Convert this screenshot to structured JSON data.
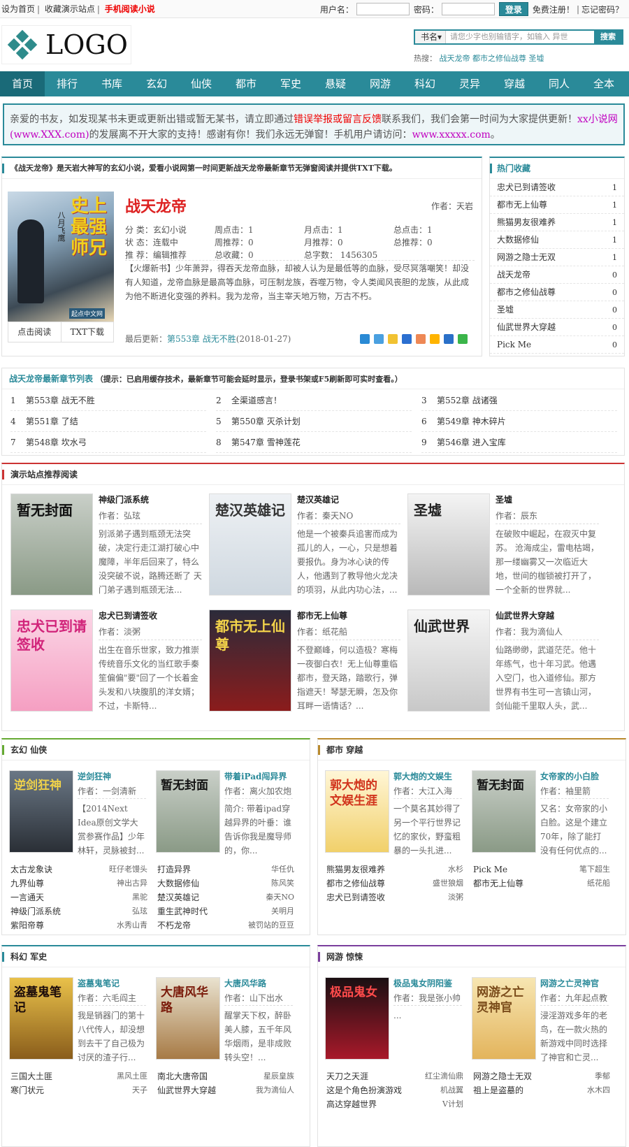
{
  "topbar": {
    "home": "设为首页",
    "fav": "收藏演示站点",
    "mobile": "手机阅读小说"
  },
  "login": {
    "user": "用户名：",
    "pass": "密码：",
    "btn": "登录",
    "reg": "免费注册！",
    "forgot": "忘记密码？"
  },
  "logo": {
    "text": "LOGO"
  },
  "search": {
    "type": "书名▾",
    "placeholder": "请您少字也别输错字，如输入 异世",
    "btn": "搜索"
  },
  "hot": {
    "label": "热搜：",
    "items": [
      "战天龙帝",
      "都市之修仙战尊",
      "圣墟"
    ]
  },
  "nav": [
    "首页",
    "排行",
    "书库",
    "玄幻",
    "仙侠",
    "都市",
    "军史",
    "悬疑",
    "网游",
    "科幻",
    "灵异",
    "穿越",
    "同人",
    "全本"
  ],
  "notice": {
    "p1": "亲爱的书友，如发现某书未更或更新出错或暂无某书，请立即通过",
    "link": "错误举报或留言反馈",
    "p2": "联系我们，我们会第一时间为大家提供更新！",
    "site": "xx小说网(www.XXX.com)",
    "p3": "的发展离不开大家的支持！感谢有你！我们永远无弹窗！手机用户请访问：",
    "url": "www.xxxxx.com",
    "p4": "。"
  },
  "book": {
    "intro": "《战天龙帝》是天岩大神写的玄幻小说，爱看小说网第一时间更新战天龙帝最新章节无弹窗阅读并提供TXT下载。",
    "title": "战天龙帝",
    "author": "作者：天岩",
    "f1": "分 类：玄幻小说",
    "f2": "周点击：1",
    "f3": "月点击：1",
    "f4": "总点击：1",
    "f5": "状 态：连载中",
    "f6": "周推荐：0",
    "f7": "月推荐：0",
    "f8": "总推荐：0",
    "f9": "推 荐：编辑推荐",
    "f10": "总收藏：0",
    "f11": "总字数： 1456305",
    "desc": "【火爆新书】少年萧羿，得吞天龙帝血脉，却被人认为是最低等的血脉，受尽冥落嘲笑！却没有人知道，龙帝血脉是最高等血脉，可压制龙族，吞噬万物，令人类闻风丧胆的龙族，从此成为他不断进化变强的养料。我为龙帝，当主宰天地万物，万古不朽。",
    "last_label": "最后更新：",
    "last_ch": "第553章 战无不胜",
    "last_date": "(2018-01-27)",
    "read": "点击阅读",
    "txt": "TXT下载",
    "cover_text": "史上最强师兄",
    "cover_author": "八月飞鹰",
    "cover_pub": "起点中文网"
  },
  "hotfav": {
    "title": "热门收藏",
    "items": [
      [
        "忠犬已到请签收",
        "1"
      ],
      [
        "都市无上仙尊",
        "1"
      ],
      [
        "熊猫男友很难养",
        "1"
      ],
      [
        "大数据修仙",
        "1"
      ],
      [
        "网游之隐士无双",
        "1"
      ],
      [
        "战天龙帝",
        "0"
      ],
      [
        "都市之修仙战尊",
        "0"
      ],
      [
        "圣墟",
        "0"
      ],
      [
        "仙武世界大穿越",
        "0"
      ],
      [
        "Pick Me",
        "0"
      ]
    ]
  },
  "chapters": {
    "title": "战天龙帝最新章节列表",
    "tip": "（提示：已启用缓存技术，最新章节可能会延时显示，登录书架或F5刷新即可实时查看。）",
    "items": [
      [
        "1",
        "第553章 战无不胜"
      ],
      [
        "2",
        "全渠道感言！"
      ],
      [
        "3",
        "第552章 战诸强"
      ],
      [
        "4",
        "第551章 了结"
      ],
      [
        "5",
        "第550章 灭杀计划"
      ],
      [
        "6",
        "第549章 神木碎片"
      ],
      [
        "7",
        "第548章 坎水弓"
      ],
      [
        "8",
        "第547章 雪神莲花"
      ],
      [
        "9",
        "第546章 进入宝库"
      ]
    ]
  },
  "rec": {
    "title": "演示站点推荐阅读",
    "items": [
      {
        "name": "神级门派系统",
        "author": "作者：弘玹",
        "desc": "别派弟子遇到瓶颈无法突破，决定行走江湖打破心中魔障，半年后回来了，特么没突破不说，路腾还断了 天门弟子遇到瓶颈无法...",
        "cover": "暂无封面"
      },
      {
        "name": "楚汉英雄记",
        "author": "作者：秦天NO",
        "desc": "他是一个被秦兵追害而成为孤儿的人，一心，只是想着要报仇。身为冰心诀的传人，他遇到了教导他火龙决的项羽，从此内功心法，...",
        "cover": "楚汉英雄记"
      },
      {
        "name": "圣墟",
        "author": "作者：辰东",
        "desc": "在破败中崛起，在寂灭中复苏。  沧海成尘，雷电枯竭，那一缕幽雾又一次临近大地，世间的枷锁被打开了，一个全新的世界就...",
        "cover": "圣墟"
      },
      {
        "name": "忠犬已到请签收",
        "author": "作者：淡粥",
        "desc": "出生在音乐世家，致力推崇传统音乐文化的当红歌手秦笙偏偏\"要\"回了一个长着金头发和八块腹肌的洋女婿；不过，卡斯特...",
        "cover": "忠犬已到请签收"
      },
      {
        "name": "都市无上仙尊",
        "author": "作者：纸花船",
        "desc": "不登巅峰，何以造极？寒梅一夜御白衣！无上仙尊重临都市，登天路，踏歌行，弹指遮天！琴瑟无瞬，怎及你耳畔一语情话？...",
        "cover": "都市无上仙尊"
      },
      {
        "name": "仙武世界大穿越",
        "author": "作者：我为滴仙人",
        "desc": "仙路缈缈，武道茫茫。他十年练气，也十年习武。他遇入空门，也入道修仙。那方世界有书生可一言镇山河，剑仙能千里取人头，武...",
        "cover": "仙武世界"
      }
    ]
  },
  "cats": [
    {
      "title": "玄幻 仙侠",
      "books": [
        {
          "name": "逆剑狂神",
          "author": "作者：一剑清新",
          "desc": "【2014Next Idea原创文学大赏参赛作品】少年林轩，灵脉被封...",
          "cover": "逆剑狂神"
        },
        {
          "name": "带着iPad闯异界",
          "author": "作者：离火加农炮",
          "desc": "简介: 带着ipad穿越异界的叶垂：谁告诉你我是魔导师的，你...",
          "cover": "暂无封面"
        }
      ],
      "list": [
        [
          "太古龙象诀",
          "旺仔老馒头",
          "打造异界",
          "华任仇"
        ],
        [
          "九界仙尊",
          "神出古异",
          "大数据修仙",
          "陈风笑"
        ],
        [
          "一言通天",
          "黑驼",
          "楚汉英雄记",
          "秦天NO"
        ],
        [
          "神级门派系统",
          "弘玹",
          "重生武神时代",
          "关明月"
        ],
        [
          "紫阳帝尊",
          "水秀山青",
          "不朽龙帝",
          "被罚站的豆豆"
        ]
      ]
    },
    {
      "title": "都市 穿越",
      "books": [
        {
          "name": "郭大炮的文娱生",
          "author": "作者：大江入海",
          "desc": "一个莫名其妙得了另一个平行世界记忆的家伙，野蛮粗暴的一头扎进...",
          "cover": "郭大炮的文娱生涯"
        },
        {
          "name": "女帝家的小白脸",
          "author": "作者：袖里箭",
          "desc": "又名：女帝家的小白脸。这是个建立70年，除了能打没有任何优点的...",
          "cover": "暂无封面"
        }
      ],
      "list": [
        [
          "熊猫男友很难养",
          "水杉",
          "Pick Me",
          "笔下超生"
        ],
        [
          "都市之修仙战尊",
          "盛世狼烟",
          "都市无上仙尊",
          "纸花船"
        ],
        [
          "忠犬已到请签收",
          "淡粥",
          "",
          ""
        ]
      ]
    },
    {
      "title": "科幻 军史",
      "books": [
        {
          "name": "盗墓鬼笔记",
          "author": "作者：六毛阎主",
          "desc": "我是销器门的第十八代传人，却没想到去干了自己极为讨厌的渣子行...",
          "cover": "盗墓鬼笔记"
        },
        {
          "name": "大唐风华路",
          "author": "作者：山下出水",
          "desc": "醒掌天下权，醉卧美人膝，五千年风华烟雨，是非成败转头空！...",
          "cover": "大唐风华路"
        }
      ],
      "list": [
        [
          "三国大土匪",
          "黑风土匪",
          "南北大唐帝国",
          "星辰皇族"
        ],
        [
          "寒门状元",
          "天子",
          "仙武世界大穿越",
          "我为滴仙人"
        ]
      ]
    },
    {
      "title": "网游 惊悚",
      "books": [
        {
          "name": "极品鬼女阴阳鉴",
          "author": "作者：我是张小帅",
          "desc": "...",
          "cover": "极品鬼女"
        },
        {
          "name": "网游之亡灵神官",
          "author": "作者：九年起点教",
          "desc": "浸淫游戏多年的老鸟，在一款火热的新游戏中同时选择了神官和亡灵...",
          "cover": "网游之亡灵神官"
        }
      ],
      "list": [
        [
          "天刀之天涯",
          "红尘滴仙鼎",
          "网游之隐士无双",
          "季郁"
        ],
        [
          "这是个角色扮演游戏",
          "机战翼",
          "祖上是盗墓的",
          "水木四"
        ],
        [
          "高达穿越世界",
          "V计划",
          "",
          ""
        ]
      ]
    }
  ]
}
